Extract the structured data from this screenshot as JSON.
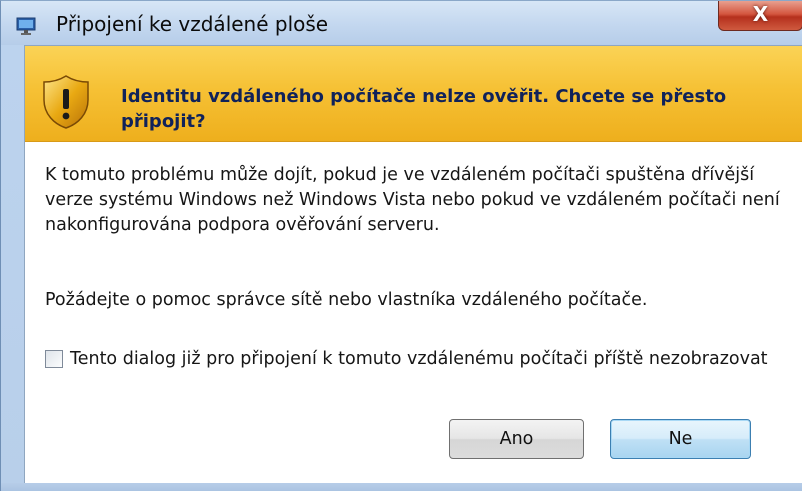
{
  "window": {
    "title": "Připojení ke vzdálené ploše",
    "close_label": "X"
  },
  "banner": {
    "heading": "Identitu vzdáleného počítače nelze ověřit. Chcete se přesto připojit?"
  },
  "body": {
    "paragraph1": "K tomuto problému může dojít, pokud je ve vzdáleném počítači spuštěna dřívější verze systému Windows než Windows Vista nebo pokud ve vzdáleném počítači není nakonfigurována podpora ověřování serveru.",
    "paragraph2": "Požádejte o pomoc správce sítě nebo vlastníka vzdáleného počítače."
  },
  "checkbox": {
    "label": "Tento dialog již pro připojení k tomuto vzdálenému počítači příště nezobrazovat",
    "checked": false
  },
  "buttons": {
    "yes_label": "Ano",
    "no_label": "Ne"
  },
  "icons": {
    "app": "remote-desktop-icon",
    "warning": "warning-shield-icon"
  },
  "colors": {
    "banner": "#f6c135",
    "heading_text": "#10225a",
    "close": "#c8432c"
  }
}
